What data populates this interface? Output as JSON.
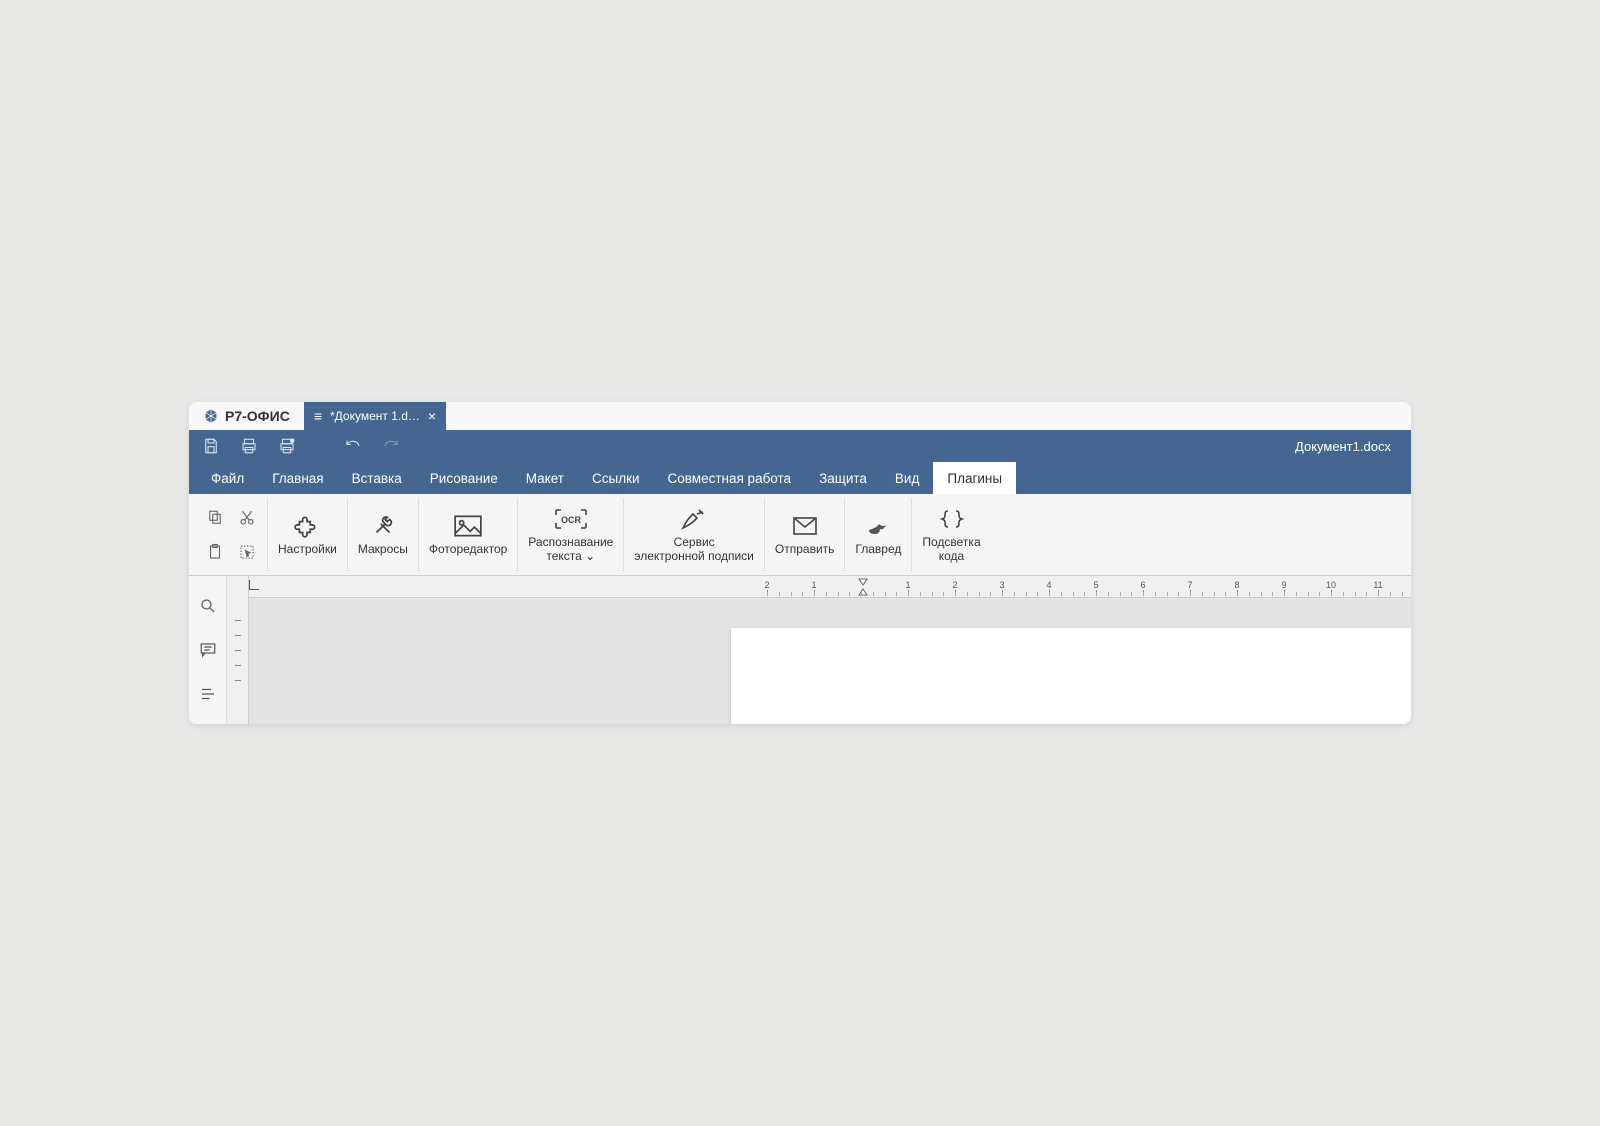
{
  "app": {
    "name": "Р7-ОФИС"
  },
  "tab": {
    "title": "*Документ 1.d…"
  },
  "document": {
    "filename": "Документ1.docx"
  },
  "menu": {
    "items": [
      "Файл",
      "Главная",
      "Вставка",
      "Рисование",
      "Макет",
      "Ссылки",
      "Совместная работа",
      "Защита",
      "Вид",
      "Плагины"
    ],
    "active_index": 9
  },
  "ribbon": {
    "settings": "Настройки",
    "macros": "Макросы",
    "photo_editor": "Фоторедактор",
    "ocr": "Распознавание\nтекста ⌄",
    "ocr_badge": "OCR",
    "signature": "Сервис\nэлектронной подписи",
    "send": "Отправить",
    "glavred": "Главред",
    "code_highlight": "Подсветка\nкода"
  },
  "ruler": {
    "left_values": [
      "2",
      "1"
    ],
    "right_values": [
      "1",
      "2",
      "3",
      "4",
      "5",
      "6",
      "7",
      "8",
      "9",
      "10",
      "11"
    ]
  }
}
